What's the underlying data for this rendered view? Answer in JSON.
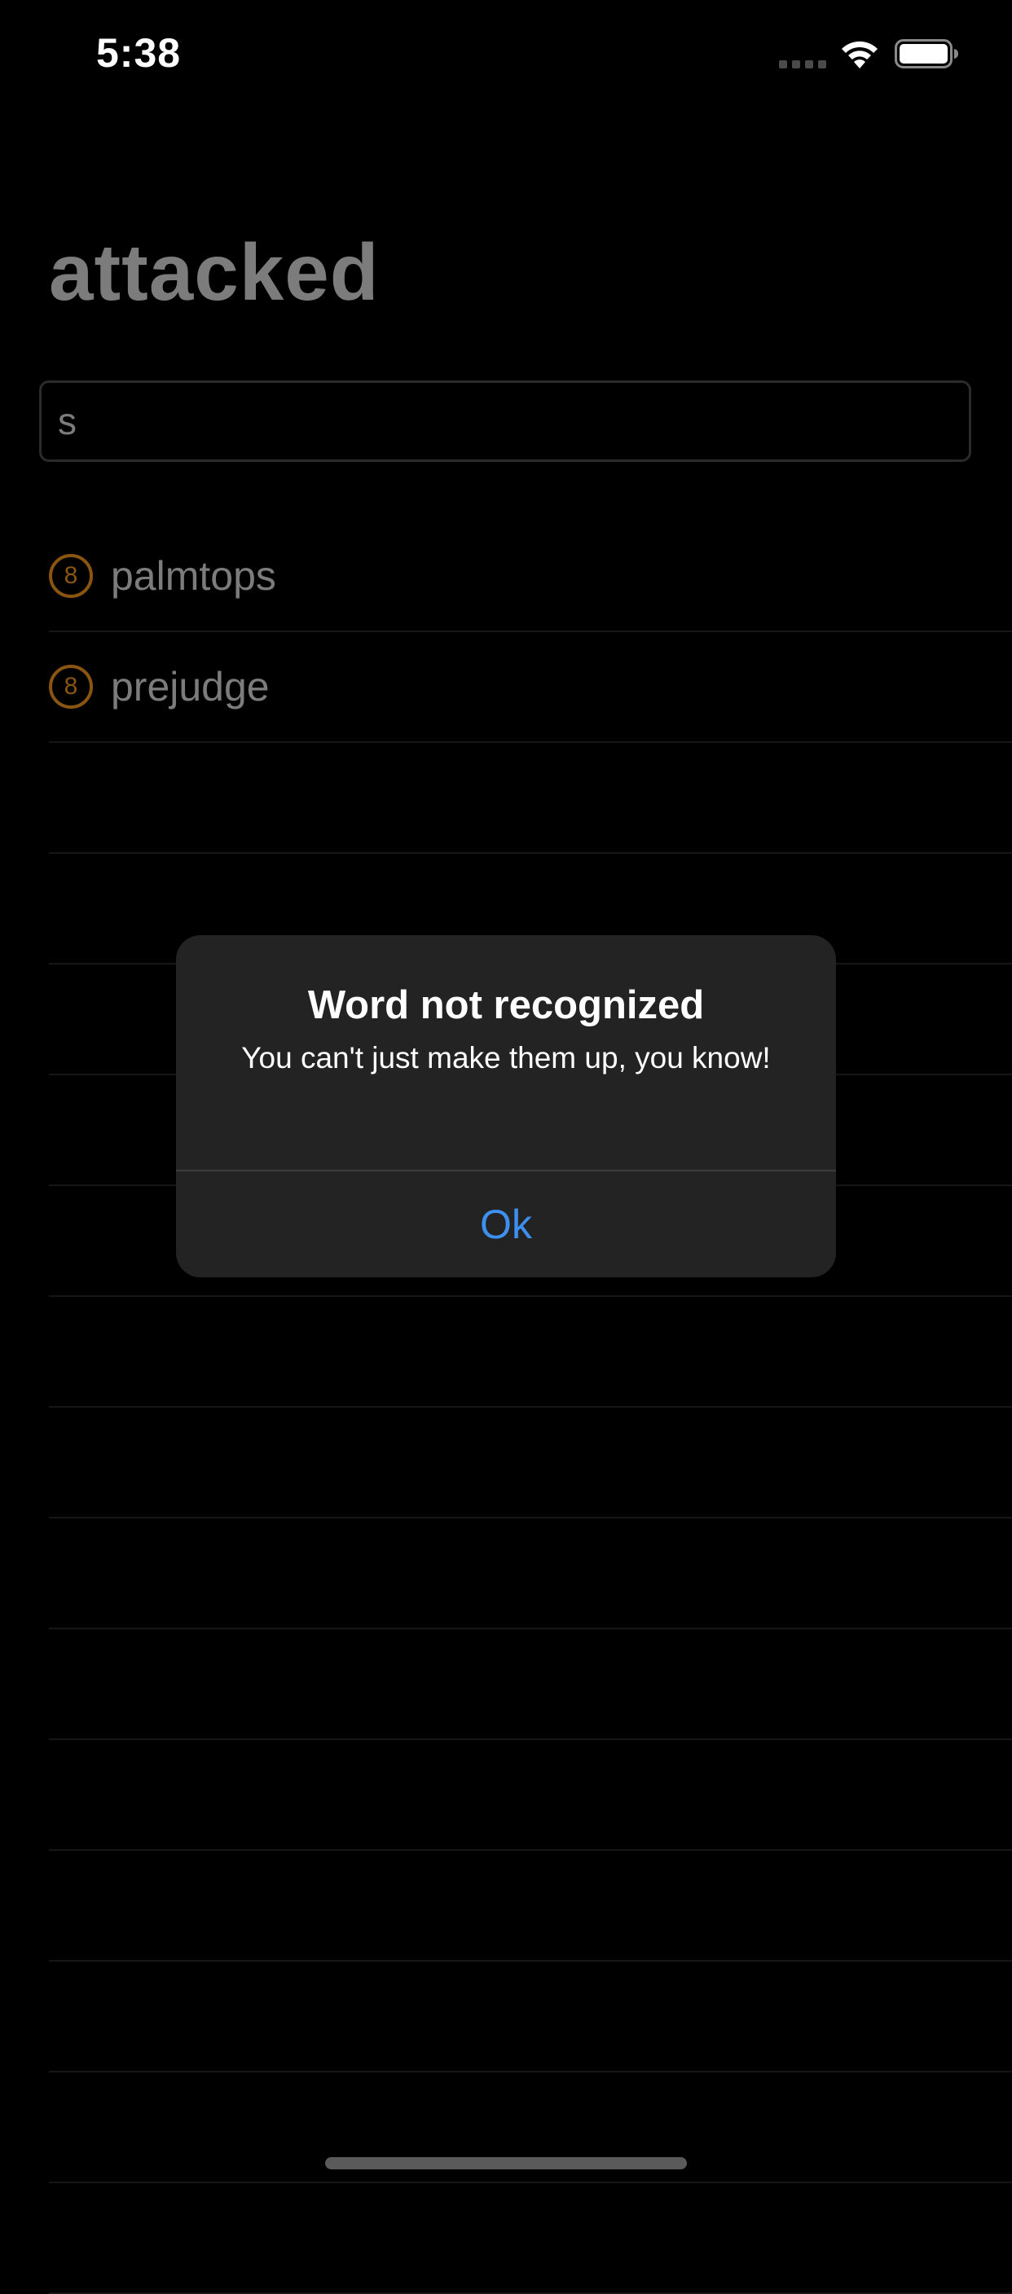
{
  "status_bar": {
    "time": "5:38",
    "icons": [
      "cellular-signal-icon",
      "wifi-icon",
      "battery-icon"
    ]
  },
  "page": {
    "title": "attacked"
  },
  "input": {
    "value": "s"
  },
  "words": [
    {
      "score": "8",
      "word": "palmtops"
    },
    {
      "score": "8",
      "word": "prejudge"
    }
  ],
  "alert": {
    "title": "Word not recognized",
    "message": "You can't just make them up, you know!",
    "ok_label": "Ok"
  },
  "colors": {
    "background": "#000000",
    "dimmed_text": "#7c7c7c",
    "score_badge": "#8a5510",
    "alert_background": "#232323",
    "accent": "#3d8ff0"
  }
}
